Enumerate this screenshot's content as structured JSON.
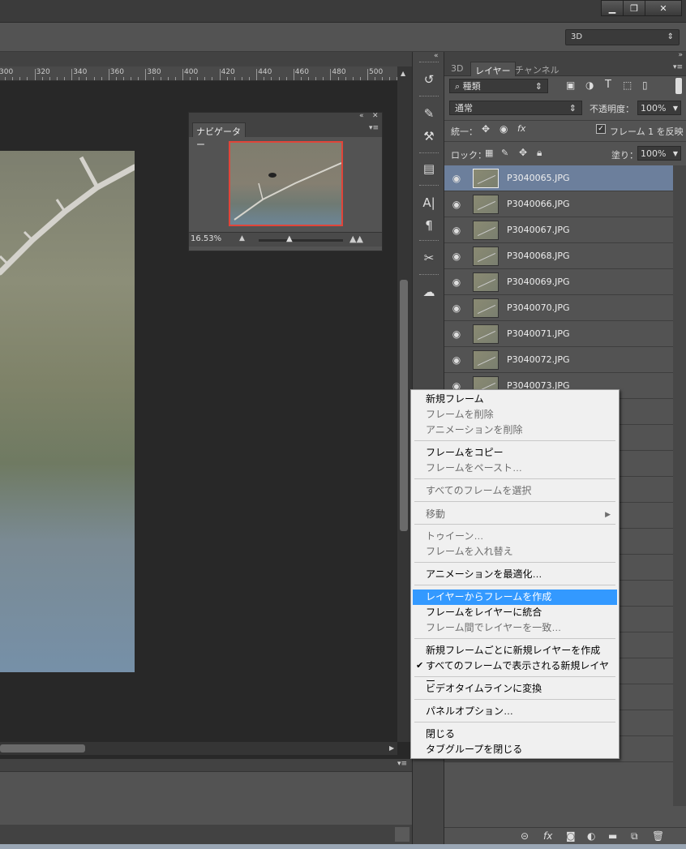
{
  "window": {
    "minimize_label": "▁",
    "restore_label": "❐",
    "close_label": "✕"
  },
  "options_bar": {
    "workspace_value": "3D"
  },
  "ruler": {
    "ticks": [
      "300",
      "320",
      "340",
      "360",
      "380",
      "400",
      "420",
      "440",
      "460",
      "480",
      "500"
    ]
  },
  "navigator": {
    "tab_label": "ナビゲーター",
    "zoom_value": "16.53%"
  },
  "layers_panel": {
    "tabs": [
      "3D",
      "レイヤー",
      "チャンネル"
    ],
    "filter_value": "種類",
    "blend_mode": "通常",
    "opacity_label": "不透明度：",
    "opacity_value": "100%",
    "unify_label": "統一：",
    "propagate_label": "フレーム 1 を反映",
    "lock_label": "ロック：",
    "fill_label": "塗り：",
    "fill_value": "100%",
    "layers": [
      {
        "name": "P3040065.JPG"
      },
      {
        "name": "P3040066.JPG"
      },
      {
        "name": "P3040067.JPG"
      },
      {
        "name": "P3040068.JPG"
      },
      {
        "name": "P3040069.JPG"
      },
      {
        "name": "P3040070.JPG"
      },
      {
        "name": "P3040071.JPG"
      },
      {
        "name": "P3040072.JPG"
      },
      {
        "name": "P3040073.JPG"
      }
    ]
  },
  "context_menu": {
    "items": [
      {
        "label": "新規フレーム",
        "enabled": true
      },
      {
        "label": "フレームを削除",
        "enabled": false
      },
      {
        "label": "アニメーションを削除",
        "enabled": false
      },
      {
        "label": "フレームをコピー",
        "enabled": true
      },
      {
        "label": "フレームをペースト…",
        "enabled": false
      },
      {
        "label": "すべてのフレームを選択",
        "enabled": false
      },
      {
        "label": "移動",
        "enabled": false
      },
      {
        "label": "トゥイーン…",
        "enabled": false
      },
      {
        "label": "フレームを入れ替え",
        "enabled": false
      },
      {
        "label": "アニメーションを最適化…",
        "enabled": true
      },
      {
        "label": "レイヤーからフレームを作成",
        "enabled": true
      },
      {
        "label": "フレームをレイヤーに統合",
        "enabled": true
      },
      {
        "label": "フレーム間でレイヤーを一致…",
        "enabled": false
      },
      {
        "label": "新規フレームごとに新規レイヤーを作成",
        "enabled": true
      },
      {
        "label": "すべてのフレームで表示される新規レイヤー",
        "enabled": true
      },
      {
        "label": "ビデオタイムラインに変換",
        "enabled": true
      },
      {
        "label": "パネルオプション…",
        "enabled": true
      },
      {
        "label": "閉じる",
        "enabled": true
      },
      {
        "label": "タブグループを閉じる",
        "enabled": true
      }
    ]
  },
  "colors": {
    "menu_highlight": "#3399ff",
    "selected_layer": "#6c7f9c",
    "navigator_frame": "#e0453a"
  },
  "icons": [
    "history-icon",
    "brush-presets-icon",
    "tool-presets-icon",
    "layer-comps-icon",
    "character-icon",
    "paragraph-icon",
    "tools-icon",
    "creative-cloud-icon",
    "eye-icon",
    "link-icon",
    "fx-icon",
    "mask-icon",
    "adjustment-icon",
    "group-icon",
    "new-layer-icon",
    "trash-icon"
  ]
}
